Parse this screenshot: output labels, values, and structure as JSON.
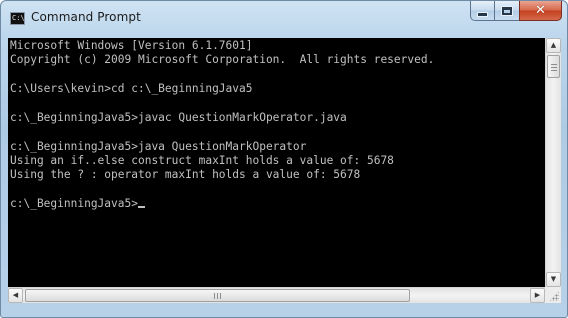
{
  "window": {
    "title": "Command Prompt",
    "icon_label": "C:\\",
    "controls": {
      "minimize_icon": "minimize-icon",
      "maximize_icon": "maximize-icon",
      "close_glyph": "✕"
    }
  },
  "console": {
    "lines": [
      "Microsoft Windows [Version 6.1.7601]",
      "Copyright (c) 2009 Microsoft Corporation.  All rights reserved.",
      "",
      "C:\\Users\\kevin>cd c:\\_BeginningJava5",
      "",
      "c:\\_BeginningJava5>javac QuestionMarkOperator.java",
      "",
      "c:\\_BeginningJava5>java QuestionMarkOperator",
      "Using an if..else construct maxInt holds a value of: 5678",
      "Using the ? : operator maxInt holds a value of: 5678",
      "",
      "c:\\_BeginningJava5>"
    ],
    "colors": {
      "background": "#000000",
      "text": "#c0c0c0"
    }
  },
  "scrollbars": {
    "up_arrow": "▲",
    "down_arrow": "▼",
    "left_arrow": "◀",
    "right_arrow": "▶"
  }
}
